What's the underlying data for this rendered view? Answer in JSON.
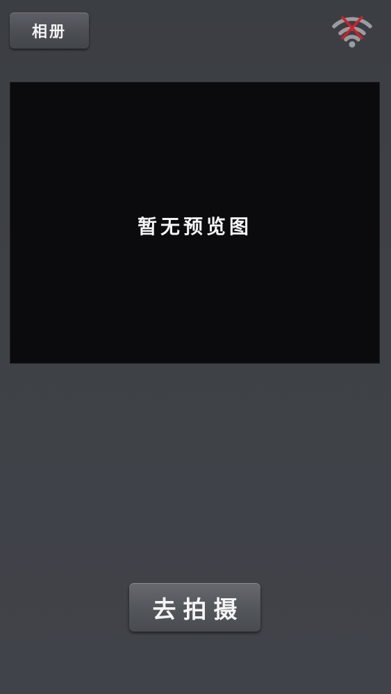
{
  "header": {
    "album_label": "相册",
    "wifi_status_icon": "wifi-disconnected-icon"
  },
  "preview": {
    "empty_text": "暂无预览图"
  },
  "actions": {
    "capture_label": "去拍摄"
  },
  "colors": {
    "background": "#3e4146",
    "preview_bg": "#0b0b0e",
    "button": "#54575c",
    "wifi_gray": "#9a9c9f",
    "wifi_error_red": "#d0202a"
  }
}
